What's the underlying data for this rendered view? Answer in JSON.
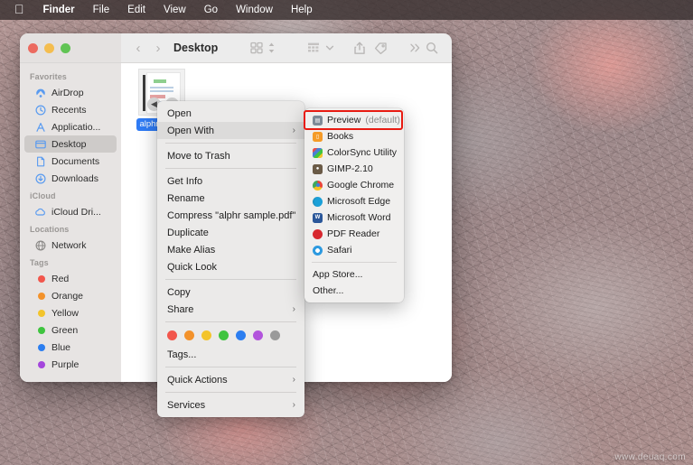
{
  "menubar": {
    "apple_logo": "apple-logo",
    "items": [
      {
        "label": "Finder",
        "bold": true
      },
      {
        "label": "File",
        "bold": false
      },
      {
        "label": "Edit",
        "bold": false
      },
      {
        "label": "View",
        "bold": false
      },
      {
        "label": "Go",
        "bold": false
      },
      {
        "label": "Window",
        "bold": false
      },
      {
        "label": "Help",
        "bold": false
      }
    ]
  },
  "finder": {
    "title": "Desktop",
    "nav": {
      "back": "‹",
      "forward": "›"
    },
    "toolbar_icons": [
      "grid-view-icon",
      "sort-chevron-icon",
      "group-by-icon",
      "chevron-down-icon",
      "share-icon",
      "tag-icon",
      "more-icon",
      "search-icon"
    ],
    "sidebar": {
      "sections": [
        {
          "header": "Favorites",
          "items": [
            {
              "label": "AirDrop",
              "icon": "airdrop-icon",
              "selected": false
            },
            {
              "label": "Recents",
              "icon": "clock-icon",
              "selected": false
            },
            {
              "label": "Applicatio...",
              "icon": "applications-icon",
              "selected": false
            },
            {
              "label": "Desktop",
              "icon": "desktop-icon",
              "selected": true
            },
            {
              "label": "Documents",
              "icon": "document-icon",
              "selected": false
            },
            {
              "label": "Downloads",
              "icon": "downloads-icon",
              "selected": false
            }
          ]
        },
        {
          "header": "iCloud",
          "items": [
            {
              "label": "iCloud Dri...",
              "icon": "cloud-icon",
              "selected": false
            }
          ]
        },
        {
          "header": "Locations",
          "items": [
            {
              "label": "Network",
              "icon": "globe-icon",
              "selected": false
            }
          ]
        },
        {
          "header": "Tags",
          "items": [
            {
              "label": "Red",
              "icon": "tag-dot-icon",
              "color": "#f2564c",
              "selected": false
            },
            {
              "label": "Orange",
              "icon": "tag-dot-icon",
              "color": "#f3922b",
              "selected": false
            },
            {
              "label": "Yellow",
              "icon": "tag-dot-icon",
              "color": "#f3c42b",
              "selected": false
            },
            {
              "label": "Green",
              "icon": "tag-dot-icon",
              "color": "#3fc43f",
              "selected": false
            },
            {
              "label": "Blue",
              "icon": "tag-dot-icon",
              "color": "#2c7ef0",
              "selected": false
            },
            {
              "label": "Purple",
              "icon": "tag-dot-icon",
              "color": "#a446dc",
              "selected": false
            }
          ]
        }
      ]
    },
    "file": {
      "name": "alphr sampl",
      "full_name": "alphr sample.pdf",
      "icon": "pdf-document-thumbnail",
      "selected": true
    }
  },
  "context_menu": {
    "groups": [
      [
        {
          "label": "Open",
          "submenu": false,
          "highlighted": false
        },
        {
          "label": "Open With",
          "submenu": true,
          "highlighted": true
        }
      ],
      [
        {
          "label": "Move to Trash",
          "submenu": false,
          "highlighted": false
        }
      ],
      [
        {
          "label": "Get Info",
          "submenu": false,
          "highlighted": false
        },
        {
          "label": "Rename",
          "submenu": false,
          "highlighted": false
        },
        {
          "label": "Compress \"alphr sample.pdf\"",
          "submenu": false,
          "highlighted": false
        },
        {
          "label": "Duplicate",
          "submenu": false,
          "highlighted": false
        },
        {
          "label": "Make Alias",
          "submenu": false,
          "highlighted": false
        },
        {
          "label": "Quick Look",
          "submenu": false,
          "highlighted": false
        }
      ],
      [
        {
          "label": "Copy",
          "submenu": false,
          "highlighted": false
        },
        {
          "label": "Share",
          "submenu": true,
          "highlighted": false
        }
      ]
    ],
    "tag_colors": [
      "#f2564c",
      "#f3922b",
      "#f3c42b",
      "#3fc43f",
      "#2c7ef0",
      "#b254dc",
      "#9a9a9a"
    ],
    "tags_label": "Tags...",
    "bottom_groups": [
      {
        "label": "Quick Actions",
        "submenu": true
      },
      {
        "label": "Services",
        "submenu": true
      }
    ],
    "submenu_arrow": "›"
  },
  "open_with_submenu": {
    "apps": [
      {
        "label": "Preview",
        "suffix": " (default)",
        "icon": "preview-app-icon",
        "color": "#5a6b7a",
        "glyph": "▤",
        "highlighted": true
      },
      {
        "label": "Books",
        "suffix": "",
        "icon": "books-app-icon",
        "color": "#f59b28",
        "glyph": "▭",
        "highlighted": false
      },
      {
        "label": "ColorSync Utility",
        "suffix": "",
        "icon": "colorsync-app-icon",
        "color": "#4a7fd4",
        "glyph": "◆",
        "highlighted": false
      },
      {
        "label": "GIMP-2.10",
        "suffix": "",
        "icon": "gimp-app-icon",
        "color": "#6a5a46",
        "glyph": "●",
        "highlighted": false
      },
      {
        "label": "Google Chrome",
        "suffix": "",
        "icon": "chrome-app-icon",
        "color": "#e9453c",
        "glyph": "●",
        "highlighted": false
      },
      {
        "label": "Microsoft Edge",
        "suffix": "",
        "icon": "edge-app-icon",
        "color": "#1ba0d8",
        "glyph": "●",
        "highlighted": false
      },
      {
        "label": "Microsoft Word",
        "suffix": "",
        "icon": "word-app-icon",
        "color": "#2a5699",
        "glyph": "W",
        "highlighted": false
      },
      {
        "label": "PDF Reader",
        "suffix": "",
        "icon": "pdf-reader-app-icon",
        "color": "#d7282f",
        "glyph": "●",
        "highlighted": false
      },
      {
        "label": "Safari",
        "suffix": "",
        "icon": "safari-app-icon",
        "color": "#2d9ae0",
        "glyph": "◎",
        "highlighted": false
      }
    ],
    "footer": [
      {
        "label": "App Store..."
      },
      {
        "label": "Other..."
      }
    ]
  },
  "annotation": {
    "target": "Preview (default)",
    "color": "#e81b12"
  },
  "watermark": "www.deuaq.com"
}
